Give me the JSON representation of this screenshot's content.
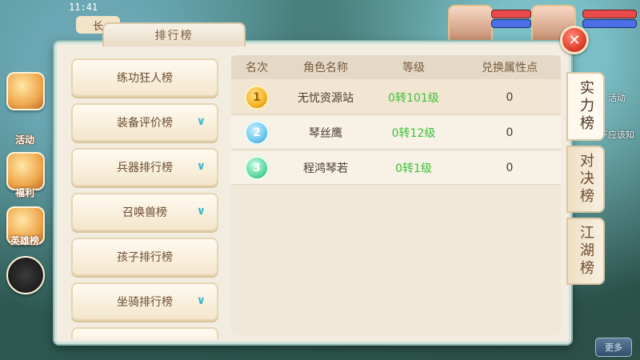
{
  "status": {
    "time": "11:41"
  },
  "location": {
    "label": "长"
  },
  "left_rail": {
    "items": [
      {
        "label": "活动"
      },
      {
        "label": "福利"
      },
      {
        "label": "英雄榜"
      }
    ]
  },
  "right_hints": {
    "activity": "活动",
    "hint_text": "这下应该知"
  },
  "bottom_bar": {
    "more_label": "更多"
  },
  "dialog": {
    "title": "排行榜",
    "close_icon": "close-icon",
    "categories": [
      {
        "label": "练功狂人榜",
        "expandable": false
      },
      {
        "label": "装备评价榜",
        "expandable": true
      },
      {
        "label": "兵器排行榜",
        "expandable": true
      },
      {
        "label": "召唤兽榜",
        "expandable": true
      },
      {
        "label": "孩子排行榜",
        "expandable": false
      },
      {
        "label": "坐骑排行榜",
        "expandable": true
      }
    ],
    "table": {
      "headers": [
        "名次",
        "角色名称",
        "等级",
        "兑换属性点"
      ],
      "rows": [
        {
          "rank": "1",
          "name": "无忧资源站",
          "level": "0转101级",
          "points": "0"
        },
        {
          "rank": "2",
          "name": "琴丝鹰",
          "level": "0转12级",
          "points": "0"
        },
        {
          "rank": "3",
          "name": "程鸿琴若",
          "level": "0转1级",
          "points": "0"
        }
      ]
    },
    "side_tabs": [
      {
        "label": "实力榜",
        "active": true
      },
      {
        "label": "对决榜",
        "active": false
      },
      {
        "label": "江湖榜",
        "active": false
      }
    ]
  }
}
